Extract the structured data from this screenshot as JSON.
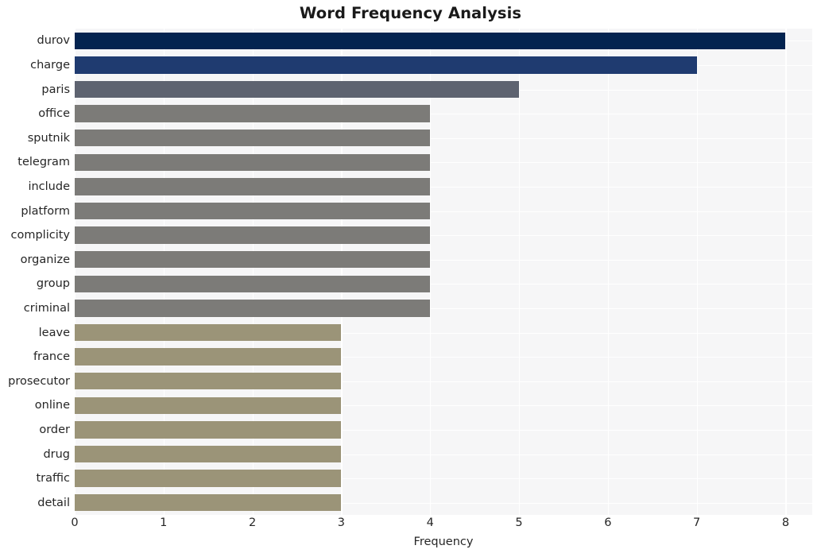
{
  "chart_data": {
    "type": "bar",
    "orientation": "horizontal",
    "title": "Word Frequency Analysis",
    "xlabel": "Frequency",
    "ylabel": "",
    "xlim": [
      0,
      8.3
    ],
    "xticks": [
      0,
      1,
      2,
      3,
      4,
      5,
      6,
      7,
      8
    ],
    "xticklabels": [
      "0",
      "1",
      "2",
      "3",
      "4",
      "5",
      "6",
      "7",
      "8"
    ],
    "grid": true,
    "grid_color": "#ffffff",
    "plot_background": "#f6f6f7",
    "figure_background": "#ffffff",
    "legend": null,
    "categories": [
      "durov",
      "charge",
      "paris",
      "office",
      "sputnik",
      "telegram",
      "include",
      "platform",
      "complicity",
      "organize",
      "group",
      "criminal",
      "leave",
      "france",
      "prosecutor",
      "online",
      "order",
      "drug",
      "traffic",
      "detail"
    ],
    "values": [
      8,
      7,
      5,
      4,
      4,
      4,
      4,
      4,
      4,
      4,
      4,
      4,
      3,
      3,
      3,
      3,
      3,
      3,
      3,
      3
    ],
    "bar_colors": [
      "#042450",
      "#1f3b70",
      "#5e6370",
      "#7c7b78",
      "#7c7b78",
      "#7c7b78",
      "#7c7b78",
      "#7c7b78",
      "#7c7b78",
      "#7c7b78",
      "#7c7b78",
      "#7c7b78",
      "#9b9478",
      "#9b9478",
      "#9b9478",
      "#9b9478",
      "#9b9478",
      "#9b9478",
      "#9b9478",
      "#9b9478"
    ],
    "bars": [
      {
        "label": "durov",
        "value": 8,
        "color": "#042450"
      },
      {
        "label": "charge",
        "value": 7,
        "color": "#1f3b70"
      },
      {
        "label": "paris",
        "value": 5,
        "color": "#5e6370"
      },
      {
        "label": "office",
        "value": 4,
        "color": "#7c7b78"
      },
      {
        "label": "sputnik",
        "value": 4,
        "color": "#7c7b78"
      },
      {
        "label": "telegram",
        "value": 4,
        "color": "#7c7b78"
      },
      {
        "label": "include",
        "value": 4,
        "color": "#7c7b78"
      },
      {
        "label": "platform",
        "value": 4,
        "color": "#7c7b78"
      },
      {
        "label": "complicity",
        "value": 4,
        "color": "#7c7b78"
      },
      {
        "label": "organize",
        "value": 4,
        "color": "#7c7b78"
      },
      {
        "label": "group",
        "value": 4,
        "color": "#7c7b78"
      },
      {
        "label": "criminal",
        "value": 4,
        "color": "#7c7b78"
      },
      {
        "label": "leave",
        "value": 3,
        "color": "#9b9478"
      },
      {
        "label": "france",
        "value": 3,
        "color": "#9b9478"
      },
      {
        "label": "prosecutor",
        "value": 3,
        "color": "#9b9478"
      },
      {
        "label": "online",
        "value": 3,
        "color": "#9b9478"
      },
      {
        "label": "order",
        "value": 3,
        "color": "#9b9478"
      },
      {
        "label": "drug",
        "value": 3,
        "color": "#9b9478"
      },
      {
        "label": "traffic",
        "value": 3,
        "color": "#9b9478"
      },
      {
        "label": "detail",
        "value": 3,
        "color": "#9b9478"
      }
    ]
  }
}
